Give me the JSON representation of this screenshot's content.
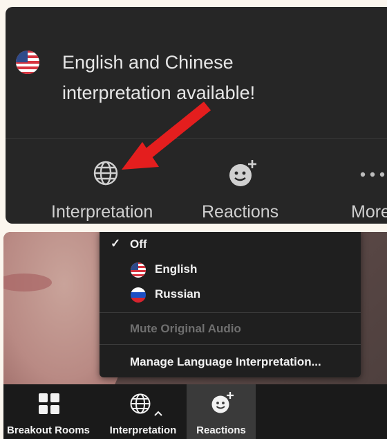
{
  "top": {
    "notification": {
      "line1": "English and Chinese",
      "line2": "interpretation available!",
      "flag_icon": "us-flag-icon"
    },
    "toolbar": {
      "interpretation_label": "Interpretation",
      "reactions_label": "Reactions",
      "more_label": "More"
    },
    "arrow_color": "#e41e1e"
  },
  "bottom": {
    "menu": {
      "off_label": "Off",
      "off_check": "✓",
      "english_label": "English",
      "russian_label": "Russian",
      "mute_label": "Mute Original Audio",
      "manage_label": "Manage Language Interpretation..."
    },
    "bar": {
      "breakout_label": "Breakout Rooms",
      "interpretation_label": "Interpretation",
      "reactions_label": "Reactions"
    }
  }
}
